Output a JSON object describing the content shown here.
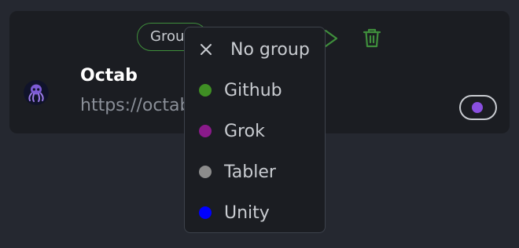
{
  "card": {
    "group_pill_label": "Group",
    "site_title": "Octab",
    "site_url": "https://octab",
    "toggle_color": "#8a4fe0"
  },
  "icons": {
    "move": "arrow-icon",
    "delete": "trash-icon",
    "favicon": "octopus-icon",
    "clear": "close-icon"
  },
  "dropdown": {
    "no_group_label": "No group",
    "groups": [
      {
        "label": "Github",
        "color": "#3f8f24"
      },
      {
        "label": "Grok",
        "color": "#8a1a8a"
      },
      {
        "label": "Tabler",
        "color": "#8c8c8c"
      },
      {
        "label": "Unity",
        "color": "#0000ff"
      }
    ]
  },
  "colors": {
    "accent_green": "#3f8f3c",
    "background": "#252830",
    "card": "#1b1d22"
  }
}
